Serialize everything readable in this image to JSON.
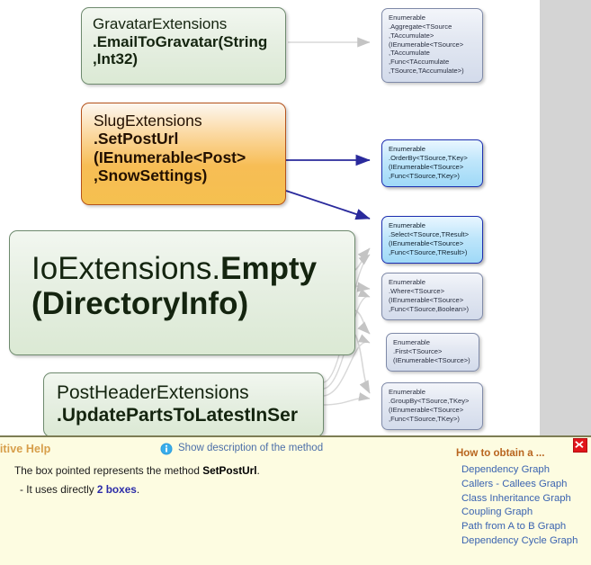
{
  "graph": {
    "method_nodes": [
      {
        "name": "gravatar-extensions-node",
        "lines": [
          {
            "text": "GravatarExtensions",
            "bold": false
          },
          {
            "text": ".EmailToGravatar(String",
            "bold": true
          },
          {
            "text": ",Int32)",
            "bold": true
          }
        ]
      },
      {
        "name": "slug-extensions-node",
        "highlight": true,
        "lines": [
          {
            "text": "SlugExtensions",
            "bold": false
          },
          {
            "text": ".SetPostUrl",
            "bold": true
          },
          {
            "text": "(IEnumerable<Post>",
            "bold": true
          },
          {
            "text": ",SnowSettings)",
            "bold": true
          }
        ]
      },
      {
        "name": "io-extensions-node",
        "lines": [
          {
            "text": "IoExtensions.",
            "bold": false,
            "inline": true
          },
          {
            "text": "Empty",
            "bold": true,
            "inline": true
          },
          {
            "text": "(DirectoryInfo)",
            "bold": true
          }
        ]
      },
      {
        "name": "post-header-extensions-node",
        "lines": [
          {
            "text": "PostHeaderExtensions",
            "bold": false
          },
          {
            "text": ".UpdatePartsToLatestInSer",
            "bold": true
          }
        ]
      }
    ],
    "library_nodes": [
      {
        "name": "enumerable-aggregate-node",
        "highlighted": false,
        "lines": [
          "Enumerable",
          ".Aggregate<TSource",
          ",TAccumulate>",
          "(IEnumerable<TSource>",
          ",TAccumulate",
          ",Func<TAccumulate",
          ",TSource,TAccumulate>)"
        ]
      },
      {
        "name": "enumerable-orderby-node",
        "highlighted": true,
        "lines": [
          "Enumerable",
          ".OrderBy<TSource,TKey>",
          "(IEnumerable<TSource>",
          ",Func<TSource,TKey>)"
        ]
      },
      {
        "name": "enumerable-select-node",
        "highlighted": true,
        "lines": [
          "Enumerable",
          ".Select<TSource,TResult>",
          "(IEnumerable<TSource>",
          ",Func<TSource,TResult>)"
        ]
      },
      {
        "name": "enumerable-where-node",
        "highlighted": false,
        "lines": [
          "Enumerable",
          ".Where<TSource>",
          "(IEnumerable<TSource>",
          ",Func<TSource,Boolean>)"
        ]
      },
      {
        "name": "enumerable-first-node",
        "highlighted": false,
        "lines": [
          "Enumerable",
          ".First<TSource>",
          "(IEnumerable<TSource>)"
        ]
      },
      {
        "name": "enumerable-groupby-node",
        "highlighted": false,
        "lines": [
          "Enumerable",
          ".GroupBy<TSource,TKey>",
          "(IEnumerable<TSource>",
          ",Func<TSource,TKey>)"
        ]
      }
    ]
  },
  "help": {
    "title": "ensitive Help",
    "info_icon": "info-circle-icon",
    "show_description_link": "Show description of the method",
    "description_prefix": "The box pointed represents the method ",
    "description_method": "SetPostUrl",
    "description_suffix": ".",
    "uses_prefix": "- It uses directly ",
    "uses_link": "2 boxes",
    "uses_suffix": ".",
    "how_to_title": "How to obtain a ...",
    "how_to_links": [
      "Dependency Graph",
      "Callers - Callees Graph",
      "Class Inheritance Graph",
      "Coupling Graph",
      "Path from A to B Graph",
      "Dependency Cycle Graph"
    ],
    "close_label": "close-button"
  },
  "colors": {
    "panel_background": "#fdfce1",
    "panel_border": "#7d7d54",
    "highlight_box": "#f5c04f",
    "method_box": "#e6efe2",
    "library_box": "#e3e8f2",
    "library_box_highlight": "#bfe6fb",
    "arrow_highlight": "#2a2a9c",
    "arrow_normal": "#c9c9c9",
    "link": "#3a63b0",
    "title": "#d79e4a",
    "close_button": "#e1151a"
  }
}
